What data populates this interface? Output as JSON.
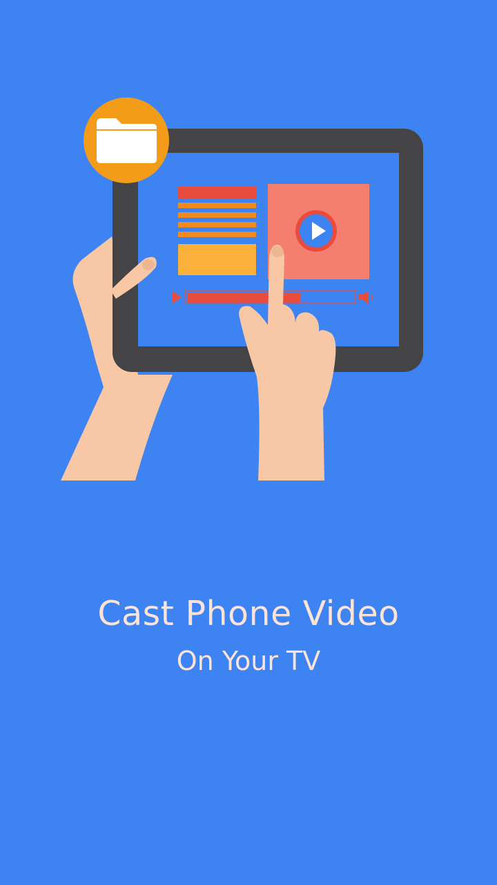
{
  "screen": {
    "background_color": "#3D83F2",
    "title": "Cast Phone Video",
    "subtitle": "On Your TV",
    "text_color": "#FCE3D6"
  },
  "illustration": {
    "folder_icon": "folder-icon",
    "play_icon": "play-icon",
    "colors": {
      "tablet_frame": "#444446",
      "tablet_screen": "#3D83F2",
      "folder_badge": "#F39C1A",
      "video_panel": "#F47F6E",
      "doc_header": "#E84C3D",
      "doc_lines": "#F28A22",
      "doc_block": "#FAB13C",
      "progress": "#E84C3D",
      "skin": "#F8C7A6",
      "skin_shade": "#EDB693"
    }
  }
}
